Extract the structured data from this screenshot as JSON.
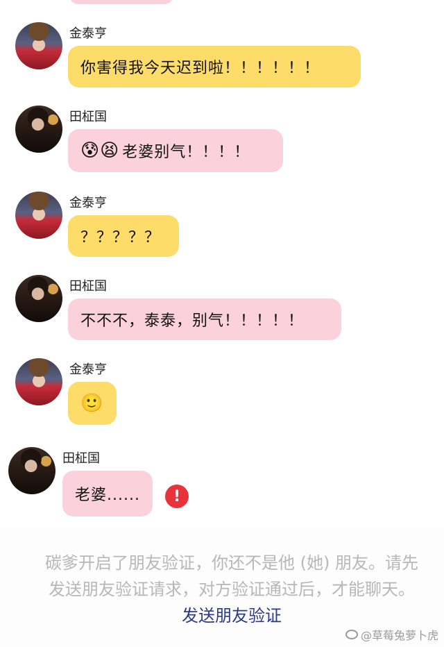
{
  "messages": [
    {
      "sender": "金泰亨",
      "side": "tae",
      "text": "你害得我今天迟到啦！！！！！！",
      "emoji": ""
    },
    {
      "sender": "田柾国",
      "side": "jk",
      "text": "老婆别气！！！！",
      "emoji": "😰😫"
    },
    {
      "sender": "金泰亨",
      "side": "tae",
      "text": "？？？？？",
      "emoji": ""
    },
    {
      "sender": "田柾国",
      "side": "jk",
      "text": "不不不，泰泰，别气！！！！！",
      "emoji": ""
    },
    {
      "sender": "金泰亨",
      "side": "tae",
      "text": "",
      "emoji": "🙂"
    },
    {
      "sender": "田柾国",
      "side": "jk",
      "text": "老婆......",
      "emoji": ""
    }
  ],
  "error_icon_glyph": "!",
  "notice": {
    "text": "碳爹开启了朋友验证，你还不是他 (她) 朋友。请先发送朋友验证请求，对方验证通过后，才能聊天。",
    "link_label": "发送朋友验证"
  },
  "watermark": {
    "text": "@草莓兔萝卜虎",
    "icon": "weibo-icon"
  },
  "colors": {
    "tae_bubble": "#fddc6a",
    "jk_bubble": "#fbd2dc",
    "error": "#e8333a",
    "link": "#2c3a86",
    "notice_text": "#b7b7b7"
  }
}
